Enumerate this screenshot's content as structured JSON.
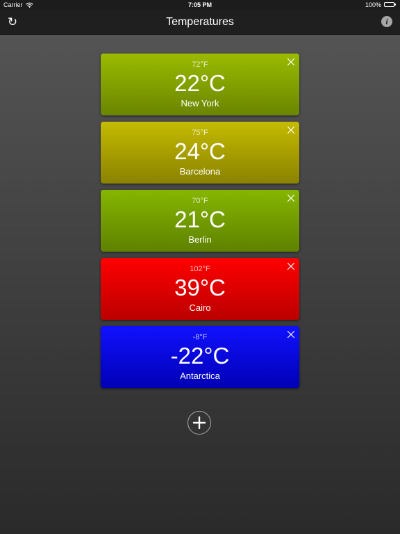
{
  "status_bar": {
    "carrier": "Carrier",
    "time": "7:05 PM",
    "battery": "100%"
  },
  "nav": {
    "title": "Temperatures",
    "refresh_icon": "refresh-icon",
    "info_icon": "info-icon",
    "info_label": "i",
    "refresh_glyph": "↻"
  },
  "cards": [
    {
      "fahrenheit": "72°F",
      "celsius": "22°C",
      "city": "New York",
      "color_top": "#9abb00",
      "color_bottom": "#6a8500"
    },
    {
      "fahrenheit": "75°F",
      "celsius": "24°C",
      "city": "Barcelona",
      "color_top": "#c4bb00",
      "color_bottom": "#8a8200"
    },
    {
      "fahrenheit": "70°F",
      "celsius": "21°C",
      "city": "Berlin",
      "color_top": "#86b600",
      "color_bottom": "#5e8100"
    },
    {
      "fahrenheit": "102°F",
      "celsius": "39°C",
      "city": "Cairo",
      "color_top": "#ff0000",
      "color_bottom": "#bb0000"
    },
    {
      "fahrenheit": "-8°F",
      "celsius": "-22°C",
      "city": "Antarctica",
      "color_top": "#1111ff",
      "color_bottom": "#0000b5"
    }
  ],
  "add_button": {
    "icon": "plus-icon"
  }
}
